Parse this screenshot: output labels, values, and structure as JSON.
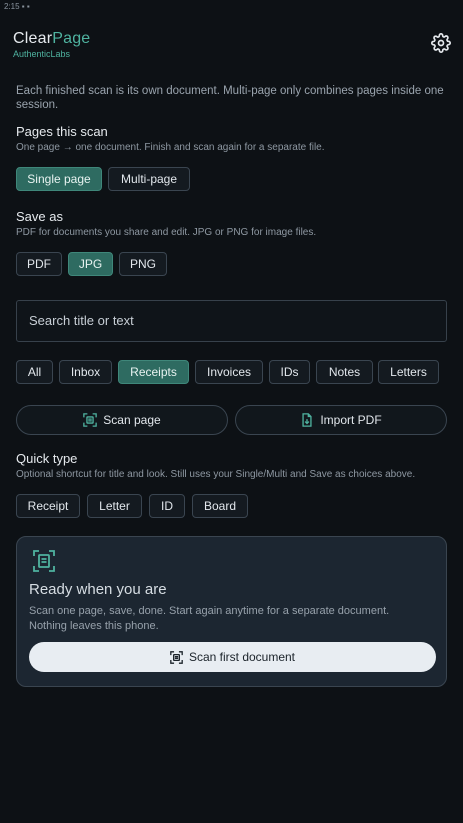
{
  "status_bar": {
    "text": "2:15 ▪ ▪"
  },
  "app": {
    "brand_first": "Clear",
    "brand_second": "Page",
    "subtitle": "AuthenticLabs"
  },
  "intro": "Each finished scan is its own document. Multi-page only combines pages inside one session.",
  "pages_section": {
    "title": "Pages this scan",
    "hint": "One page → one document. Finish and scan again for a separate file.",
    "options": [
      {
        "label": "Single page",
        "selected": true
      },
      {
        "label": "Multi-page",
        "selected": false
      }
    ]
  },
  "save_section": {
    "title": "Save as",
    "hint": "PDF for documents you share and edit. JPG or PNG for image files.",
    "options": [
      {
        "label": "PDF",
        "selected": false
      },
      {
        "label": "JPG",
        "selected": true
      },
      {
        "label": "PNG",
        "selected": false
      }
    ]
  },
  "search": {
    "placeholder": "Search title or text"
  },
  "filters": [
    {
      "label": "All",
      "selected": false
    },
    {
      "label": "Inbox",
      "selected": false
    },
    {
      "label": "Receipts",
      "selected": true
    },
    {
      "label": "Invoices",
      "selected": false
    },
    {
      "label": "IDs",
      "selected": false
    },
    {
      "label": "Notes",
      "selected": false
    },
    {
      "label": "Letters",
      "selected": false
    }
  ],
  "actions": {
    "scan_label": "Scan page",
    "import_label": "Import PDF"
  },
  "quick_type": {
    "title": "Quick type",
    "hint": "Optional shortcut for title and look. Still uses your Single/Multi and Save as choices above.",
    "options": [
      "Receipt",
      "Letter",
      "ID",
      "Board"
    ]
  },
  "empty_card": {
    "title": "Ready when you are",
    "line1": "Scan one page, save, done. Start again anytime for a separate document.",
    "line2": "Nothing leaves this phone.",
    "button_label": "Scan first document"
  },
  "icons": {
    "settings": "gear-icon",
    "scan": "scan-frame-icon",
    "import": "file-import-icon"
  },
  "colors": {
    "accent": "#4fb3a0",
    "selected_chip": "#2e6b61",
    "background": "#0d1115",
    "card": "#1c2631"
  }
}
